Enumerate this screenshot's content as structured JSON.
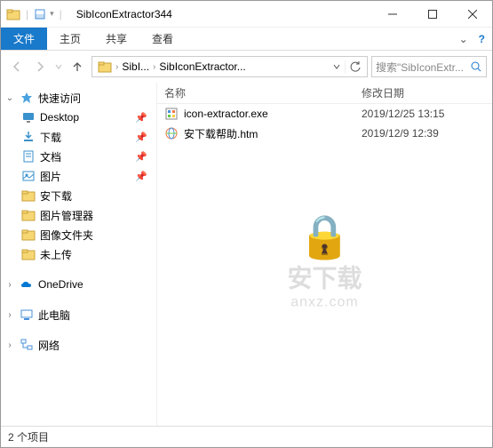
{
  "titlebar": {
    "title": "SibIconExtractor344"
  },
  "ribbon": {
    "file": "文件",
    "home": "主页",
    "share": "共享",
    "view": "查看"
  },
  "breadcrumb": {
    "part1": "SibI...",
    "part2": "SibIconExtractor..."
  },
  "search": {
    "placeholder": "搜索\"SibIconExtr..."
  },
  "sidebar": {
    "quickaccess": "快速访问",
    "items": [
      {
        "label": "Desktop"
      },
      {
        "label": "下载"
      },
      {
        "label": "文档"
      },
      {
        "label": "图片"
      },
      {
        "label": "安下载"
      },
      {
        "label": "图片管理器"
      },
      {
        "label": "图像文件夹"
      },
      {
        "label": "未上传"
      }
    ],
    "onedrive": "OneDrive",
    "thispc": "此电脑",
    "network": "网络"
  },
  "columns": {
    "name": "名称",
    "date": "修改日期"
  },
  "files": [
    {
      "name": "icon-extractor.exe",
      "date": "2019/12/25 13:15",
      "type": "exe"
    },
    {
      "name": "安下载帮助.htm",
      "date": "2019/12/9 12:39",
      "type": "htm"
    }
  ],
  "statusbar": {
    "text": "2 个项目"
  },
  "watermark": {
    "text1": "安下载",
    "text2": "anxz.com"
  }
}
